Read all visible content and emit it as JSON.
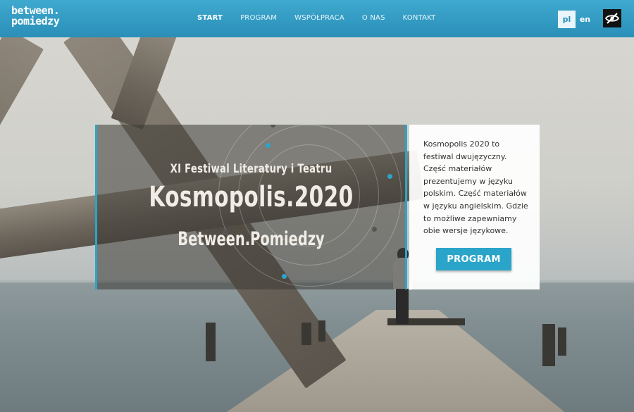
{
  "header": {
    "logo_line1": "between.",
    "logo_line2": "pomiedzy",
    "nav": [
      {
        "label": "START",
        "active": true
      },
      {
        "label": "PROGRAM",
        "active": false
      },
      {
        "label": "WSPÓŁPRACA",
        "active": false
      },
      {
        "label": "O NAS",
        "active": false
      },
      {
        "label": "KONTAKT",
        "active": false
      }
    ],
    "lang_pl": "pl",
    "lang_en": "en",
    "accessibility_icon": "eye-slash-icon"
  },
  "hero": {
    "subtitle": "XI Festiwal Literatury i Teatru",
    "title": "Kosmopolis.2020",
    "tagline": "Between.Pomiedzy"
  },
  "info": {
    "text": "Kosmopolis 2020 to festiwal dwujęzyczny. Część materiałów prezentujemy w języku polskim. Część materiałów w języku angielskim. Gdzie to możliwe zapewniamy obie wersje językowe.",
    "button": "PROGRAM"
  },
  "colors": {
    "accent": "#2aa5c9",
    "header": "#2a8fb8"
  }
}
